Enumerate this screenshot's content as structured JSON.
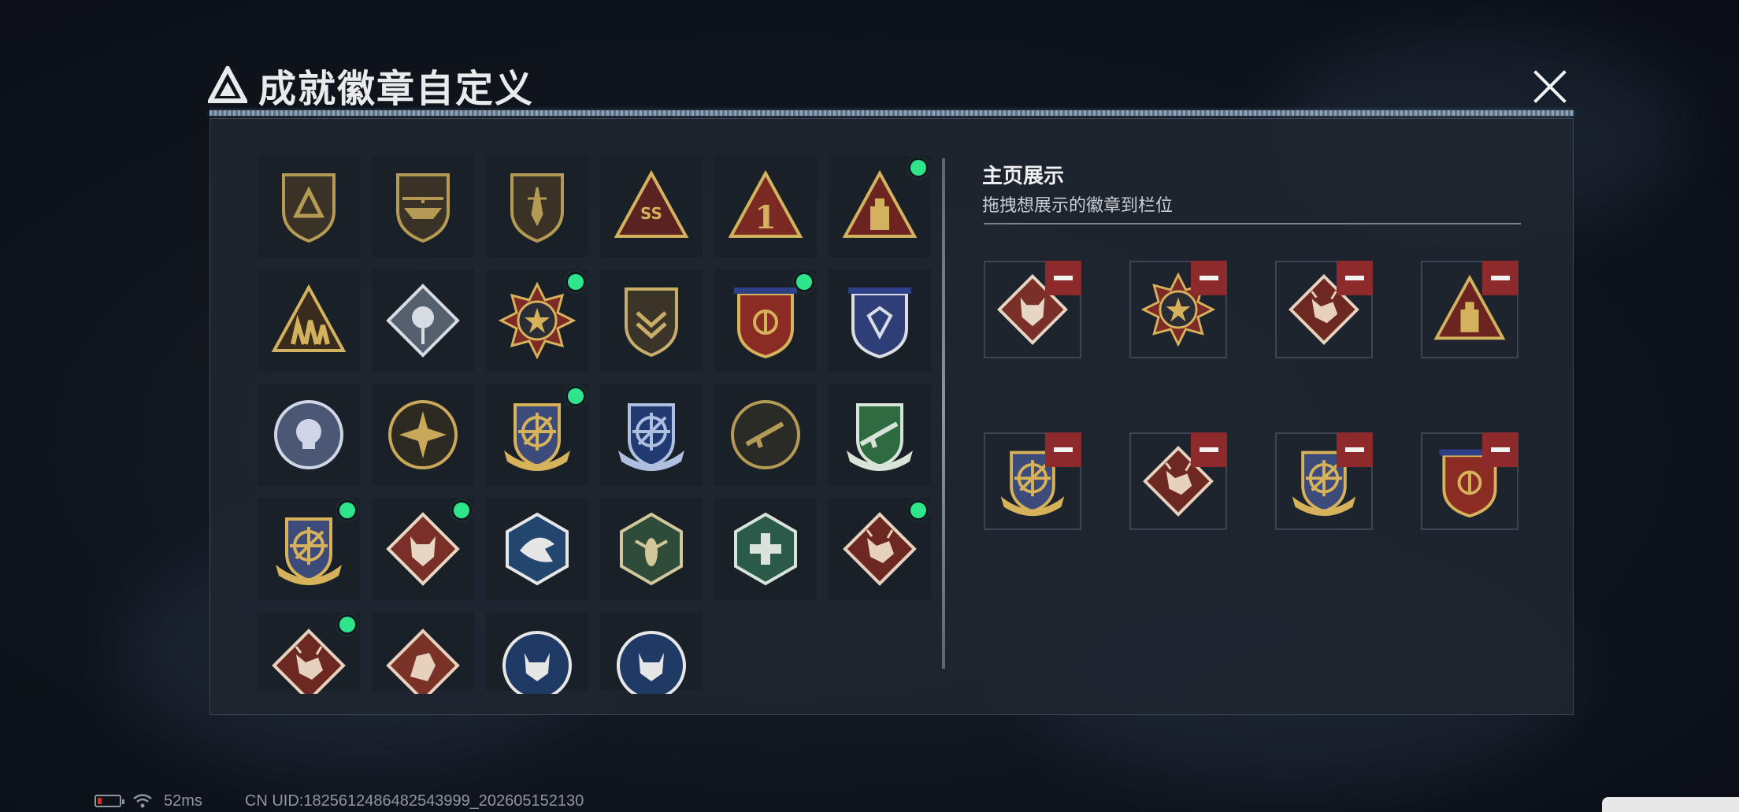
{
  "dialog": {
    "title": "成就徽章自定义",
    "close_icon": "close-icon"
  },
  "badges": [
    {
      "name": "triangle-logo-shield-badge",
      "emblem": "triangle",
      "color": "#b59a55",
      "base": "#3a3226",
      "shape": "shield",
      "dot": false
    },
    {
      "name": "helicopter-shield-badge",
      "emblem": "helicopter",
      "color": "#b59a55",
      "base": "#3a3226",
      "shape": "shield",
      "dot": false
    },
    {
      "name": "dagger-shield-badge",
      "emblem": "dagger",
      "color": "#b59a55",
      "base": "#3a3226",
      "shape": "shield",
      "dot": false
    },
    {
      "name": "ss-wings-triangle-badge",
      "emblem": "SS",
      "color": "#d2b25e",
      "base": "#5b2222",
      "shape": "triangle",
      "dot": false
    },
    {
      "name": "number-one-triangle-badge",
      "emblem": "1",
      "color": "#d2b25e",
      "base": "#7a2a23",
      "shape": "triangle",
      "dot": false
    },
    {
      "name": "usb-triangle-badge",
      "emblem": "usb",
      "color": "#d2b25e",
      "base": "#6b2420",
      "shape": "triangle",
      "dot": true
    },
    {
      "name": "squad-triangle-badge",
      "emblem": "squad",
      "color": "#d2b25e",
      "base": "#3a2c1c",
      "shape": "triangle",
      "dot": false
    },
    {
      "name": "rose-diamond-badge",
      "emblem": "rose",
      "color": "#d7dbe2",
      "base": "#55606e",
      "shape": "diamond",
      "dot": false
    },
    {
      "name": "star-skull-medal-badge",
      "emblem": "star",
      "color": "#d6b25a",
      "base": "#7c2b27",
      "shape": "medal",
      "dot": true
    },
    {
      "name": "chevron-shield-badge",
      "emblem": "chevron",
      "color": "#c8ad6a",
      "base": "#3b3428",
      "shape": "shield",
      "dot": false
    },
    {
      "name": "eagle-crest-red-badge",
      "emblem": "crest",
      "color": "#d6b25a",
      "base": "#8a2b24",
      "shape": "crest",
      "dot": true
    },
    {
      "name": "diamond-crest-blue-badge",
      "emblem": "gem",
      "color": "#d9dde6",
      "base": "#2e3f78",
      "shape": "crest",
      "dot": false
    },
    {
      "name": "skull-round-silver-badge",
      "emblem": "skull",
      "color": "#cfd6e6",
      "base": "#4b5775",
      "shape": "round",
      "dot": false
    },
    {
      "name": "burst-round-gold-badge",
      "emblem": "burst",
      "color": "#c9a85a",
      "base": "#2d2a22",
      "shape": "round",
      "dot": false
    },
    {
      "name": "crosshair-gold-shield-badge",
      "emblem": "crosshair",
      "color": "#d6b25a",
      "base": "#3d4b7a",
      "shape": "shield-wing",
      "dot": true
    },
    {
      "name": "crosshair-blue-shield-badge",
      "emblem": "crosshair",
      "color": "#aebfe0",
      "base": "#223a72",
      "shape": "shield-wing",
      "dot": false
    },
    {
      "name": "rifle-round-dark-badge",
      "emblem": "rifle",
      "color": "#b59a55",
      "base": "#2a2a26",
      "shape": "round",
      "dot": false
    },
    {
      "name": "rifle-green-shield-badge",
      "emblem": "rifle",
      "color": "#d9e4d8",
      "base": "#2f6b41",
      "shape": "shield-wing",
      "dot": false
    },
    {
      "name": "crosshair-gold-shield-badge-2",
      "emblem": "crosshair",
      "color": "#d6b25a",
      "base": "#3d4b7a",
      "shape": "shield-wing",
      "dot": true
    },
    {
      "name": "wolf-diamond-badge",
      "emblem": "wolf",
      "color": "#e6d7c4",
      "base": "#7a3028",
      "shape": "diamond",
      "dot": true
    },
    {
      "name": "eagle-hexagon-badge",
      "emblem": "eagle",
      "color": "#e6e6e6",
      "base": "#23466e",
      "shape": "hex",
      "dot": false
    },
    {
      "name": "insect-hexagon-badge",
      "emblem": "insect",
      "color": "#d2c79a",
      "base": "#2f4b3a",
      "shape": "hex",
      "dot": false
    },
    {
      "name": "medic-hexagon-badge",
      "emblem": "medic",
      "color": "#d9e3dc",
      "base": "#2c5a4a",
      "shape": "hex",
      "dot": false
    },
    {
      "name": "dragon-diamond-badge",
      "emblem": "dragon",
      "color": "#e6d1bf",
      "base": "#6e2822",
      "shape": "diamond",
      "dot": true
    },
    {
      "name": "dragon-diamond-badge-2",
      "emblem": "dragon",
      "color": "#e6d1bf",
      "base": "#6e2822",
      "shape": "diamond",
      "dot": true
    },
    {
      "name": "beast-diamond-badge",
      "emblem": "beast",
      "color": "#e6d1bf",
      "base": "#7a3226",
      "shape": "diamond",
      "dot": false
    },
    {
      "name": "lynx-round-blue-badge",
      "emblem": "lynx",
      "color": "#e6e6e6",
      "base": "#1f3a64",
      "shape": "round",
      "dot": false
    },
    {
      "name": "lynx-round-blue-badge-2",
      "emblem": "lynx",
      "color": "#e6e6e6",
      "base": "#1f3a64",
      "shape": "round",
      "dot": false
    }
  ],
  "showcase": {
    "title": "主页展示",
    "subtitle": "拖拽想展示的徽章到栏位",
    "slots": [
      {
        "name": "slot-wolf-diamond",
        "emblem": "wolf",
        "color": "#e6d7c4",
        "base": "#7a3028",
        "shape": "diamond"
      },
      {
        "name": "slot-star-medal",
        "emblem": "star",
        "color": "#d6b25a",
        "base": "#7c2b27",
        "shape": "medal"
      },
      {
        "name": "slot-dragon-diamond",
        "emblem": "dragon",
        "color": "#e6d1bf",
        "base": "#6e2822",
        "shape": "diamond"
      },
      {
        "name": "slot-usb-triangle",
        "emblem": "usb",
        "color": "#d2b25e",
        "base": "#6b2420",
        "shape": "triangle"
      },
      {
        "name": "slot-crosshair-shield",
        "emblem": "crosshair",
        "color": "#d6b25a",
        "base": "#3d4b7a",
        "shape": "shield-wing"
      },
      {
        "name": "slot-dragon-diamond-2",
        "emblem": "dragon",
        "color": "#e6d1bf",
        "base": "#6e2822",
        "shape": "diamond"
      },
      {
        "name": "slot-crosshair-shield-2",
        "emblem": "crosshair",
        "color": "#d6b25a",
        "base": "#3d4b7a",
        "shape": "shield-wing"
      },
      {
        "name": "slot-eagle-crest",
        "emblem": "crest",
        "color": "#d6b25a",
        "base": "#8a2b24",
        "shape": "crest"
      }
    ]
  },
  "status_bar": {
    "ping": "52ms",
    "uid": "CN UID:1825612486482543999_202605152130",
    "battery_icon": "battery-icon",
    "wifi_icon": "wifi-icon"
  },
  "colors": {
    "online_dot": "#2fe58c",
    "remove_button": "#8d2a2c",
    "panel_bg": "#1f2630"
  }
}
